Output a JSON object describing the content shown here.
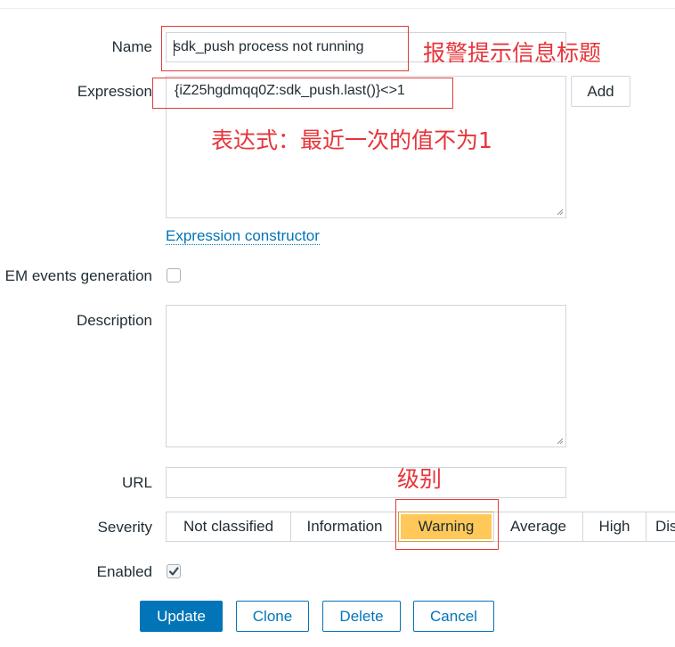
{
  "form": {
    "name_label": "Name",
    "name_value": "sdk_push process not running",
    "expression_label": "Expression",
    "expression_value": "{iZ25hgdmqq0Z:sdk_push.last()}<>1",
    "add_button": "Add",
    "expression_constructor_link": "Expression constructor",
    "ok_event_label": "EM events generation",
    "ok_event_checked": false,
    "description_label": "Description",
    "description_value": "",
    "url_label": "URL",
    "url_value": "",
    "severity_label": "Severity",
    "severity_options": [
      "Not classified",
      "Information",
      "Warning",
      "Average",
      "High",
      "Dis"
    ],
    "severity_selected": "Warning",
    "enabled_label": "Enabled",
    "enabled_checked": true
  },
  "actions": {
    "update": "Update",
    "clone": "Clone",
    "delete": "Delete",
    "cancel": "Cancel"
  },
  "annotations": {
    "name_note": "报警提示信息标题",
    "expression_note": "表达式：最近一次的值不为1",
    "severity_note": "级别"
  },
  "colors": {
    "accent": "#0275b8",
    "warning": "#ffc859",
    "annotation": "#e8343a"
  }
}
